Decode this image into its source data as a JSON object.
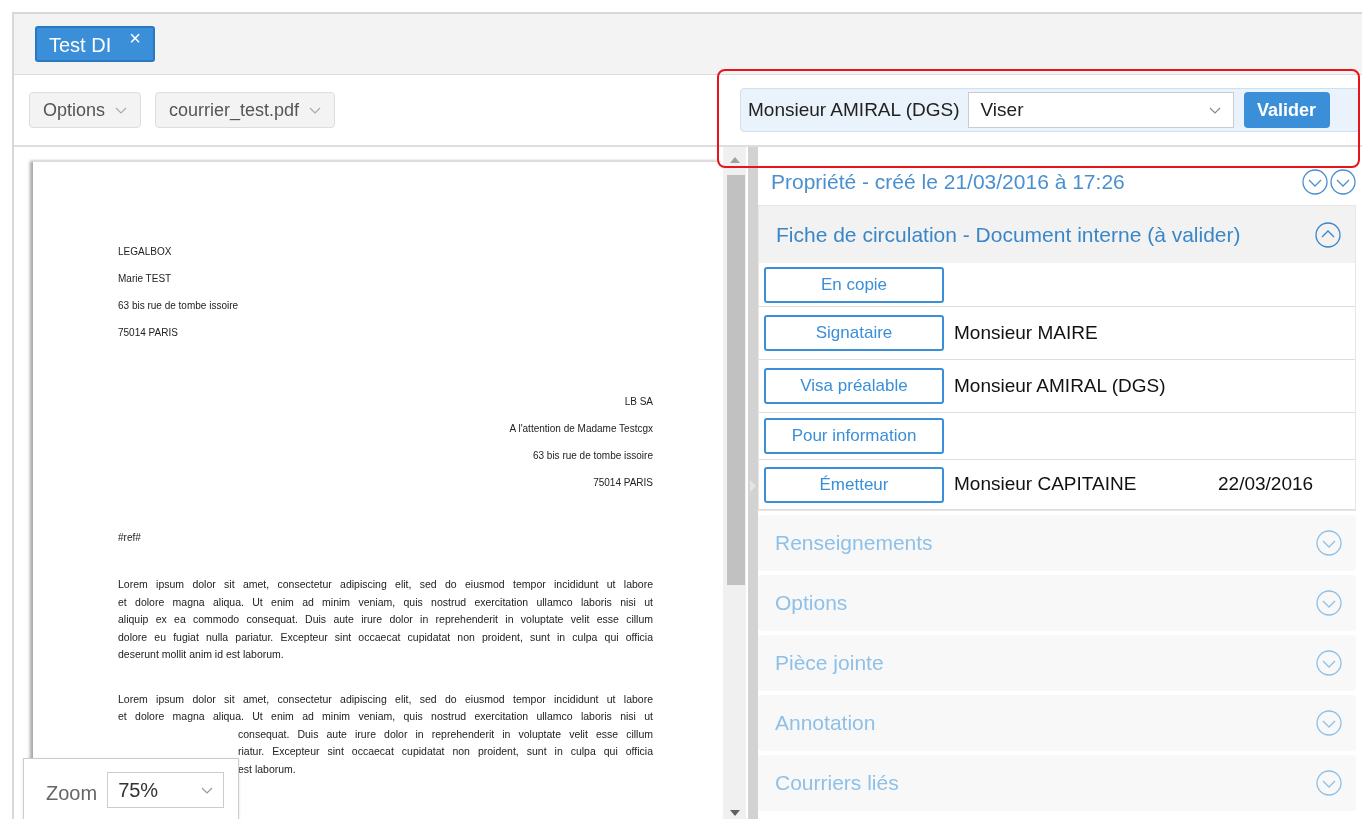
{
  "tabs": [
    {
      "label": "Test DI",
      "selected": true,
      "close": "×"
    }
  ],
  "toolbar": [
    {
      "label": "Options"
    },
    {
      "label": "courrier_test.pdf"
    }
  ],
  "document": {
    "sender": [
      "LEGALBOX",
      "Marie TEST",
      "63 bis rue de tombe issoire",
      "75014 PARIS"
    ],
    "recipient": [
      "LB SA",
      "A l'attention de Madame Testcgx",
      "63 bis rue de tombe issoire",
      "75014 PARIS"
    ],
    "reference": "#ref#",
    "paragraphs": [
      {
        "covered": false,
        "lines": [
          "Lorem ipsum dolor sit amet, consectetur adipiscing elit, sed do eiusmod tempor incididunt ut labore",
          "et dolore magna aliqua. Ut enim ad minim veniam, quis nostrud exercitation ullamco laboris nisi ut",
          "aliquip ex ea commodo consequat. Duis aute irure dolor in reprehenderit in voluptate velit esse cillum",
          "dolore eu fugiat nulla pariatur. Excepteur sint occaecat cupidatat non proident, sunt in culpa qui officia",
          "deserunt mollit anim id est laborum."
        ]
      },
      {
        "covered": true,
        "lines": [
          "Lorem ipsum dolor sit amet, consectetur adipiscing elit, sed do eiusmod tempor incididunt ut labore",
          "et dolore magna aliqua. Ut enim ad minim veniam, quis nostrud exercitation ullamco laboris nisi ut",
          "consequat. Duis aute irure dolor in reprehenderit in voluptate velit esse cillum",
          "riatur. Excepteur sint occaecat cupidatat non proident, sunt in culpa qui officia",
          "est laborum."
        ]
      }
    ]
  },
  "zoom": {
    "label": "Zoom",
    "value": "75%"
  },
  "action_bar": {
    "person": "Monsieur AMIRAL (DGS)",
    "action": "Viser",
    "button": "Valider"
  },
  "property_header": {
    "title": "Propriété - créé le 21/03/2016 à 17:26"
  },
  "circulation": {
    "title": "Fiche de circulation - Document interne (à valider)",
    "expanded": true,
    "rows": [
      {
        "role": "En copie"
      },
      {
        "role": "Signataire",
        "person": "Monsieur MAIRE"
      },
      {
        "role": "Visa préalable",
        "person": "Monsieur AMIRAL (DGS)"
      },
      {
        "role": "Pour information"
      },
      {
        "role": "Émetteur",
        "person": "Monsieur CAPITAINE",
        "date": "22/03/2016"
      }
    ]
  },
  "sections": [
    {
      "title": "Renseignements",
      "expanded": false
    },
    {
      "title": "Options",
      "expanded": false
    },
    {
      "title": "Pièce jointe",
      "expanded": false
    },
    {
      "title": "Annotation",
      "expanded": false
    },
    {
      "title": "Courriers liés",
      "expanded": false
    }
  ]
}
